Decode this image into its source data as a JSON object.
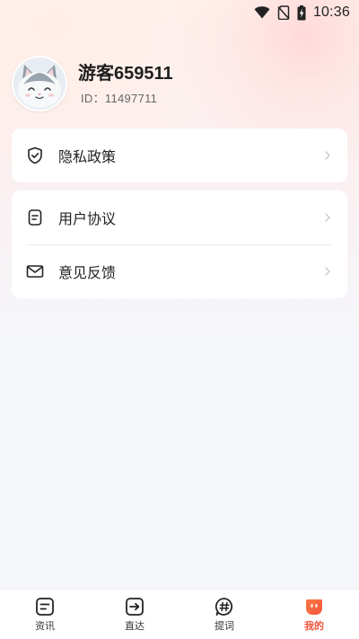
{
  "status_bar": {
    "time": "10:36",
    "icons": [
      "wifi-icon",
      "no-sim-icon",
      "battery-charging-icon"
    ]
  },
  "profile": {
    "name": "游客659511",
    "id": "ID：11497711",
    "avatar": "cat-avatar"
  },
  "menu": {
    "privacy_policy": "隐私政策",
    "user_agreement": "用户协议",
    "feedback": "意见反馈"
  },
  "tabbar": {
    "items": [
      {
        "label": "资讯",
        "icon": "news-icon",
        "active": false
      },
      {
        "label": "直达",
        "icon": "direct-arrow-icon",
        "active": false
      },
      {
        "label": "提词",
        "icon": "hashtag-icon",
        "active": false
      },
      {
        "label": "我的",
        "icon": "mine-icon",
        "active": true
      }
    ]
  },
  "colors": {
    "accent": "#f0533b",
    "background": "#f5f6fa",
    "card": "#ffffff"
  }
}
